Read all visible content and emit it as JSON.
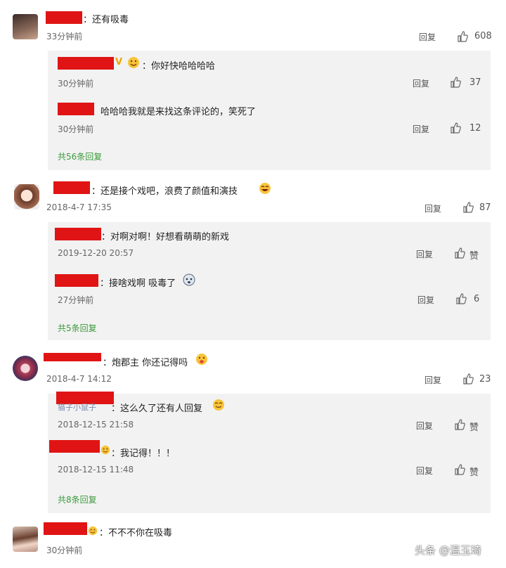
{
  "comments": [
    {
      "text": "：还有吸毒",
      "time": "33分钟前",
      "reply_label": "回复",
      "likes": "608",
      "replies": [
        {
          "text": "：你好快哈哈哈哈",
          "time": "30分钟前",
          "reply_label": "回复",
          "likes": "37"
        },
        {
          "text": "哈哈哈我就是来找这条评论的，笑死了",
          "time": "30分钟前",
          "reply_label": "回复",
          "likes": "12"
        }
      ],
      "more": "共56条回复"
    },
    {
      "text": "：还是接个戏吧，浪费了颜值和演技",
      "time": "2018-4-7 17:35",
      "reply_label": "回复",
      "likes": "87",
      "replies": [
        {
          "text": "：对啊对啊！好想看萌萌的新戏",
          "time": "2019-12-20 20:57",
          "reply_label": "回复",
          "likes": "赞"
        },
        {
          "text": "：接啥戏啊 吸毒了",
          "time": "27分钟前",
          "reply_label": "回复",
          "likes": "6"
        }
      ],
      "more": "共5条回复"
    },
    {
      "text": "：炮郡主 你还记得吗",
      "time": "2018-4-7 14:12",
      "reply_label": "回复",
      "likes": "23",
      "replies": [
        {
          "name_fragment": "猫子小鼠子",
          "text": "：这么久了还有人回复",
          "time": "2018-12-15 21:58",
          "reply_label": "回复",
          "likes": "赞"
        },
        {
          "text": "：我记得！！！",
          "time": "2018-12-15 11:48",
          "reply_label": "回复",
          "likes": "赞"
        }
      ],
      "more": "共8条回复"
    },
    {
      "text": "：不不不你在吸毒",
      "time": "30分钟前"
    }
  ],
  "watermark": "头条 @温玉琦",
  "icons": [
    "thumbs-up-icon",
    "emoji-icon",
    "avatar"
  ]
}
